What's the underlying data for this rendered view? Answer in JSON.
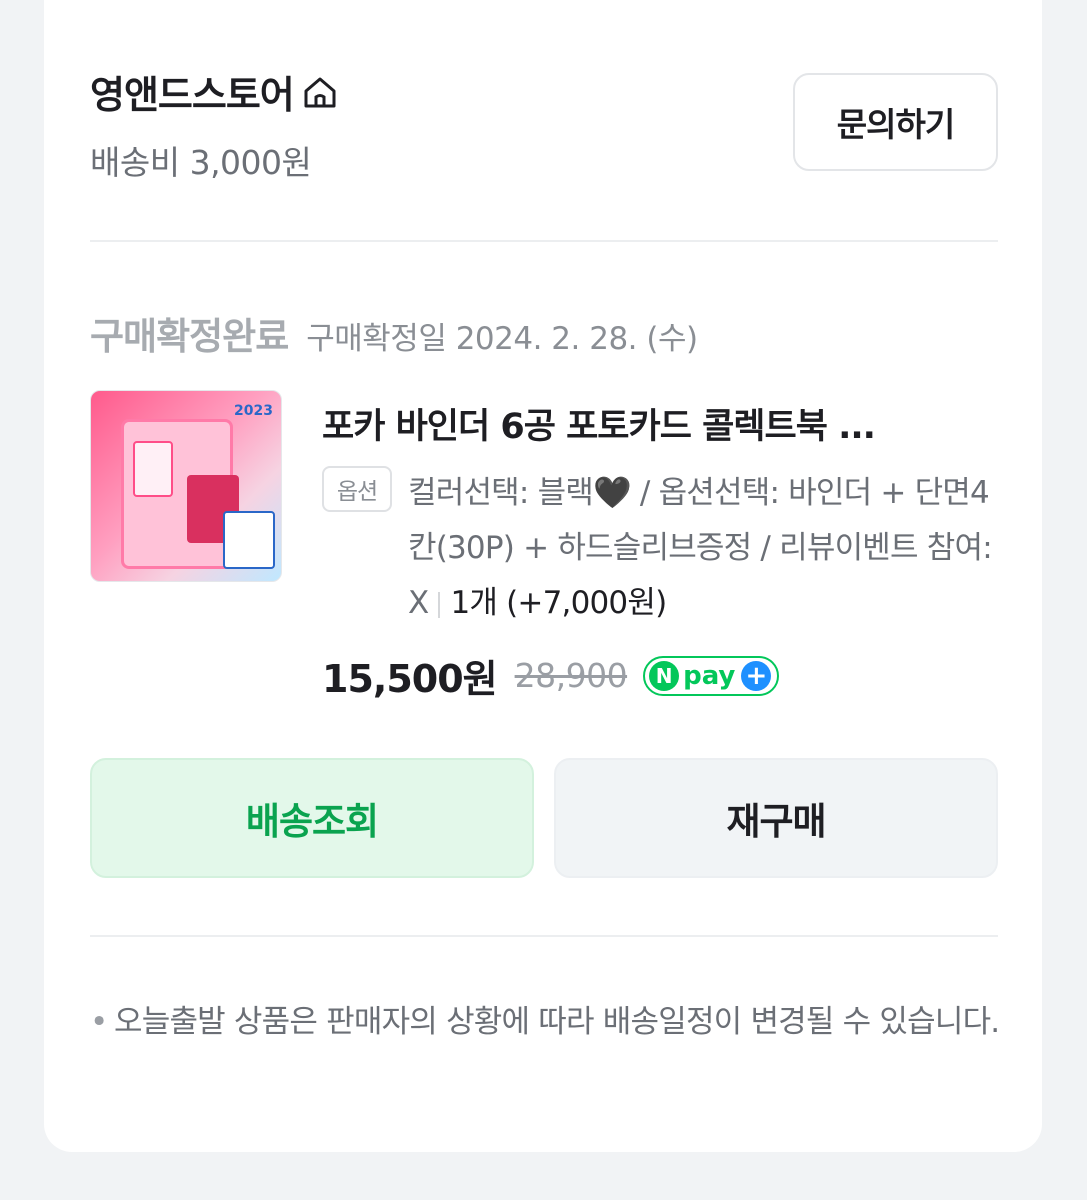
{
  "store": {
    "name": "영앤드스토어",
    "shipping_fee": "배송비 3,000원",
    "inquiry_label": "문의하기"
  },
  "order": {
    "status": "구매확정완료",
    "status_date": "구매확정일 2024. 2. 28. (수)",
    "product": {
      "title": "포카 바인더 6공 포토카드 콜렉트북 ...",
      "option_tag": "옵션",
      "option_text": "컬러선택: 블랙🖤 / 옵션선택: 바인더 + 단면4칸(30P) + 하드슬리브증정 / 리뷰이벤트 참여: X",
      "quantity": "1개 (+7,000원)",
      "thumbnail_year": "2023",
      "price": "15,500원",
      "original_price": "28,900",
      "npay_n": "N",
      "npay_label": "pay",
      "npay_plus": "+"
    }
  },
  "actions": {
    "track_label": "배송조회",
    "rebuy_label": "재구매"
  },
  "notice": "오늘출발 상품은 판매자의 상황에 따라 배송일정이 변경될 수 있습니다.",
  "colors": {
    "accent_green": "#03c75a",
    "track_bg": "#e3f8ea",
    "rebuy_bg": "#f1f4f6"
  }
}
